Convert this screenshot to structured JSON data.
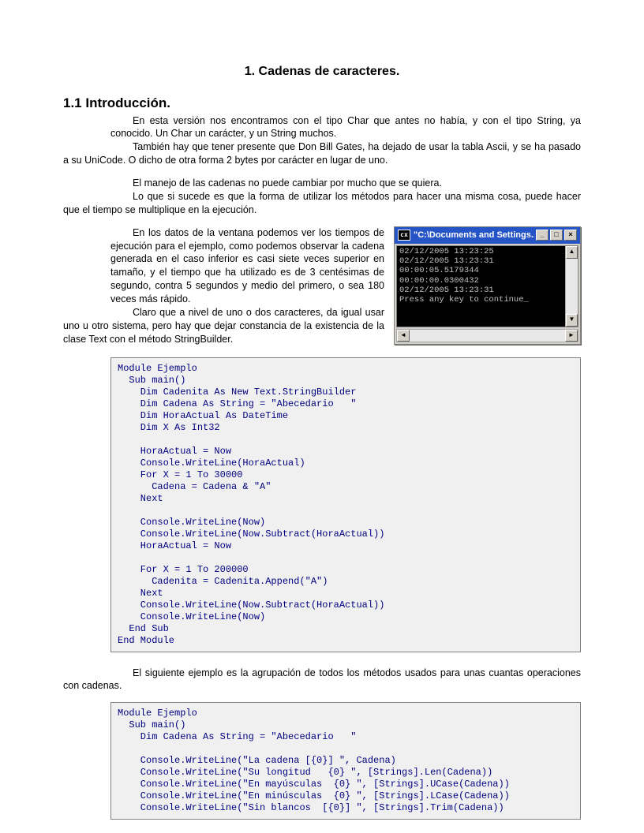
{
  "title": "1.  Cadenas de caracteres.",
  "heading11": "1.1  Introducción.",
  "p1": "En esta versión nos encontramos con el tipo Char que antes no había, y con el tipo String, ya conocido. Un Char un carácter, y un String muchos.",
  "p2": "También hay que tener presente que Don Bill Gates, ha dejado de usar la tabla Ascii, y se ha pasado a su UniCode. O dicho de otra forma 2 bytes por carácter en lugar de uno.",
  "p3": "El manejo de las cadenas no puede cambiar por mucho que se quiera.",
  "p4": "Lo que si sucede es que la forma de utilizar los métodos para hacer una misma cosa, puede hacer que el tiempo se multiplique en la ejecución.",
  "p5": "En los datos de la ventana podemos ver los tiempos de ejecución para el ejemplo, como podemos observar la cadena generada en el caso inferior es casi siete veces superior en tamaño, y el tiempo que ha utilizado es de 3 centésimas de segundo, contra 5 segundos y medio del primero, o sea 180 veces más rápido.",
  "p6": "Claro que a nivel de uno o dos caracteres, da igual usar uno u otro sistema, pero hay que dejar constancia de la existencia de la clase Text con el método StringBuilder.",
  "p7": "El siguiente ejemplo es la agrupación de todos los métodos usados para unas cuantas operaciones con cadenas.",
  "console": {
    "title_prefix": "\"C:\\Documents and Settings...",
    "icon_label": "cx",
    "lines": "02/12/2005 13:23:25\n02/12/2005 13:23:31\n00:00:05.5179344\n00:00:00.0300432\n02/12/2005 13:23:31\nPress any key to continue_"
  },
  "code1": "Module Ejemplo\n  Sub main()\n    Dim Cadenita As New Text.StringBuilder\n    Dim Cadena As String = \"Abecedario   \"\n    Dim HoraActual As DateTime\n    Dim X As Int32\n\n    HoraActual = Now\n    Console.WriteLine(HoraActual)\n    For X = 1 To 30000\n      Cadena = Cadena & \"A\"\n    Next\n\n    Console.WriteLine(Now)\n    Console.WriteLine(Now.Subtract(HoraActual))\n    HoraActual = Now\n\n    For X = 1 To 200000\n      Cadenita = Cadenita.Append(\"A\")\n    Next\n    Console.WriteLine(Now.Subtract(HoraActual))\n    Console.WriteLine(Now)\n  End Sub\nEnd Module",
  "code2": "Module Ejemplo\n  Sub main()\n    Dim Cadena As String = \"Abecedario   \"\n\n    Console.WriteLine(\"La cadena [{0}] \", Cadena)\n    Console.WriteLine(\"Su longitud   {0} \", [Strings].Len(Cadena))\n    Console.WriteLine(\"En mayúsculas  {0} \", [Strings].UCase(Cadena))\n    Console.WriteLine(\"En minúsculas  {0} \", [Strings].LCase(Cadena))\n    Console.WriteLine(\"Sin blancos  [{0}] \", [Strings].Trim(Cadena))"
}
